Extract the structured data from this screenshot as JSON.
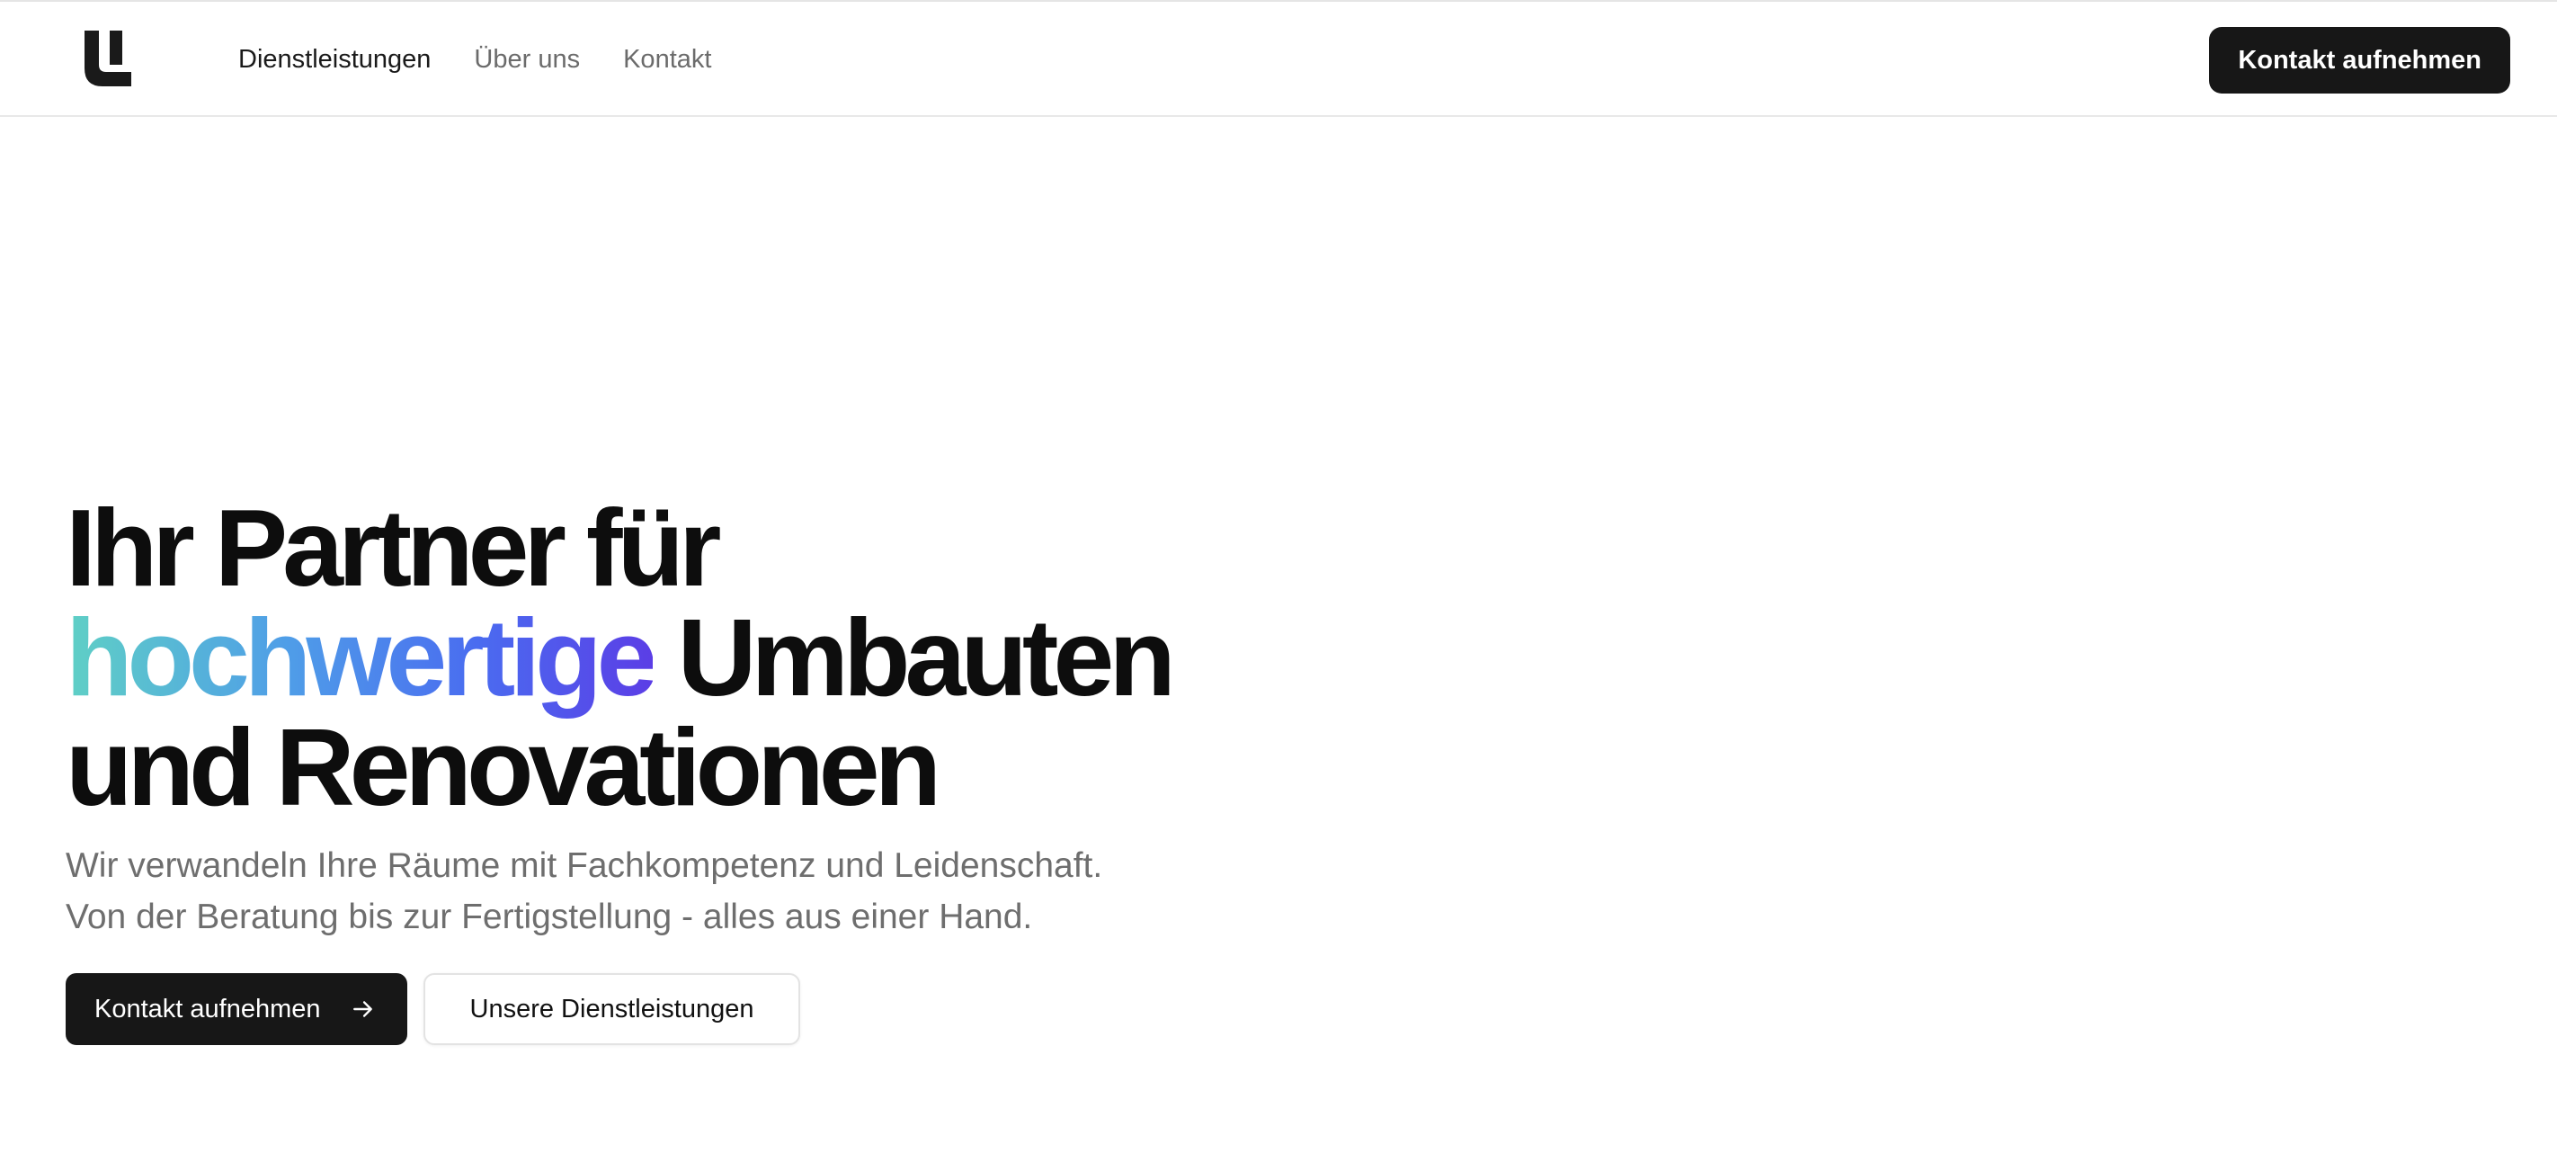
{
  "header": {
    "logo_icon": "brand-logo-icon",
    "nav": [
      {
        "label": "Dienstleistungen",
        "active": true
      },
      {
        "label": "Über uns",
        "active": false
      },
      {
        "label": "Kontakt",
        "active": false
      }
    ],
    "cta_label": "Kontakt aufnehmen"
  },
  "hero": {
    "title_line1": "Ihr Partner für",
    "title_highlight": "hochwertige",
    "title_line2_rest": " Umbauten",
    "title_line3": "und Renovationen",
    "subtitle": "Wir verwandeln Ihre Räume mit Fachkompetenz und Leidenschaft. Von der Beratung bis zur Fertigstellung - alles aus einer Hand.",
    "primary_button": "Kontakt aufnehmen",
    "primary_button_icon": "arrow-right-icon",
    "secondary_button": "Unsere Dienstleistungen"
  },
  "colors": {
    "primary": "#171717",
    "muted_text": "#6e6e6e",
    "gradient": [
      "#5fd0c5",
      "#4f9de8",
      "#4a6cf0",
      "#5b3ee6"
    ]
  }
}
